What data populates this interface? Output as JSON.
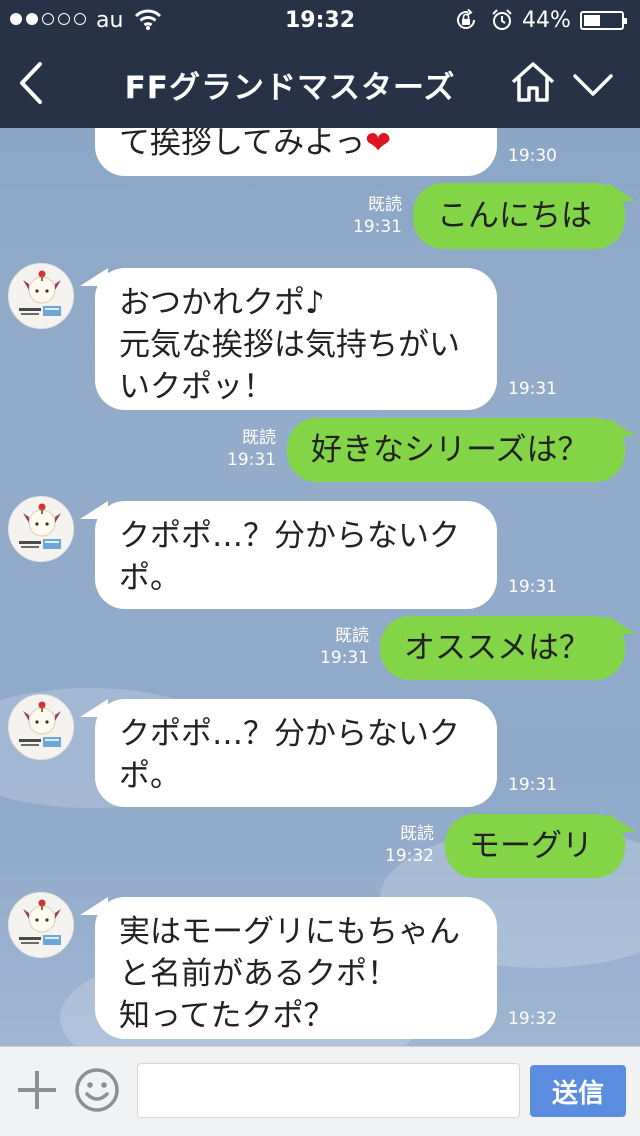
{
  "status_bar": {
    "carrier": "au",
    "time": "19:32",
    "battery_percent": "44%",
    "battery_level": 0.44,
    "signal_bars_filled": 2,
    "signal_bars_total": 5,
    "icons": [
      "wifi-icon",
      "rotation-lock-icon",
      "alarm-icon",
      "battery-icon"
    ]
  },
  "nav": {
    "title": "FFグランドマスターズ",
    "icons": [
      "back-icon",
      "home-icon",
      "chevron-down-icon"
    ]
  },
  "messages": [
    {
      "side": "in",
      "lines": [
        "て挨拶してみよっ",
        "❤"
      ],
      "time": "19:30"
    },
    {
      "side": "out",
      "text": "こんにちは",
      "read": "既読",
      "time": "19:31"
    },
    {
      "side": "in",
      "lines": [
        "おつかれクポ♪",
        "元気な挨拶は気持ちがい",
        "いクポッ！"
      ],
      "time": "19:31"
    },
    {
      "side": "out",
      "text": "好きなシリーズは？",
      "read": "既読",
      "time": "19:31"
    },
    {
      "side": "in",
      "lines": [
        "クポポ…？分からないク",
        "ポ。"
      ],
      "time": "19:31"
    },
    {
      "side": "out",
      "text": "オススメは？",
      "read": "既読",
      "time": "19:31"
    },
    {
      "side": "in",
      "lines": [
        "クポポ…？分からないク",
        "ポ。"
      ],
      "time": "19:31"
    },
    {
      "side": "out",
      "text": "モーグリ",
      "read": "既読",
      "time": "19:32"
    },
    {
      "side": "in",
      "lines": [
        "実はモーグリにもちゃん",
        "と名前があるクポ！",
        "知ってたクポ？"
      ],
      "time": "19:32"
    }
  ],
  "input_bar": {
    "placeholder": "",
    "send_label": "送信",
    "icons": [
      "plus-icon",
      "emoji-icon"
    ]
  },
  "colors": {
    "header_bg": "#273247",
    "chat_bg": "#8fa9c8",
    "outgoing_bubble": "#84d447",
    "incoming_bubble": "#ffffff",
    "send_button": "#5a8de0"
  }
}
